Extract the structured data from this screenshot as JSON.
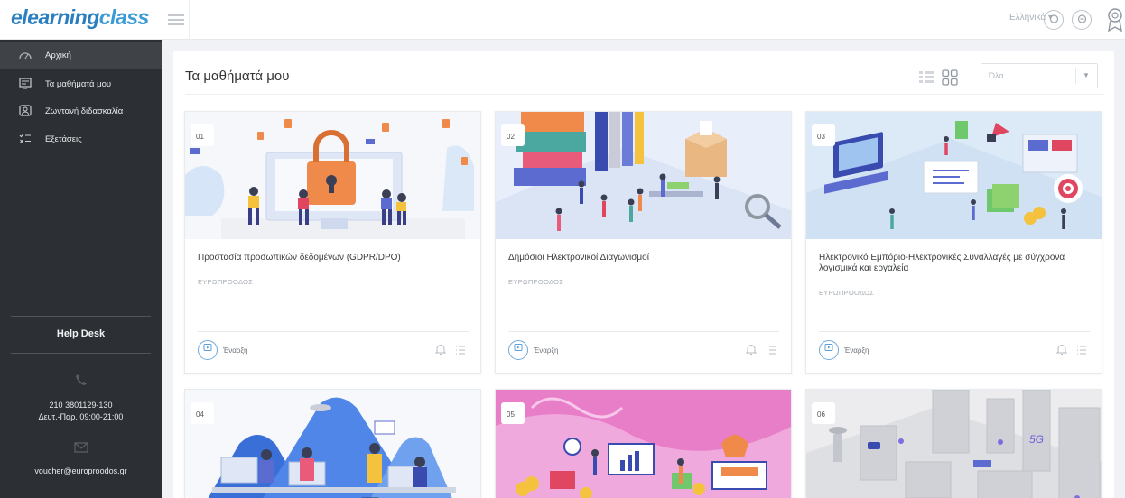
{
  "header": {
    "logo_part1": "elearning",
    "logo_part2": "class",
    "language": "Ελληνικά ▾",
    "colors": {
      "accent": "#2f9bd3",
      "sidebar_bg": "#2c2f33",
      "page_bg": "#f0f2f5"
    }
  },
  "sidebar": {
    "items": [
      {
        "label": "Αρχική",
        "icon": "dashboard-icon"
      },
      {
        "label": "Τα μαθήματά μου",
        "icon": "courses-icon"
      },
      {
        "label": "Ζωντανή διδασκαλία",
        "icon": "live-teaching-icon"
      },
      {
        "label": "Εξετάσεις",
        "icon": "exams-icon"
      }
    ],
    "help": {
      "title": "Help Desk",
      "phone": "210 3801129-130",
      "hours": "Δευτ.-Παρ. 09:00-21:00",
      "email": "voucher@europroodos.gr"
    }
  },
  "main": {
    "title": "Τα μαθήματά μου",
    "filter_value": "Όλα",
    "cards": [
      {
        "num": "01",
        "title": "Προστασία προσωπικών δεδομένων (GDPR/DPO)",
        "subtitle": "ΕΥΡΩΠΡΟΟΔΟΣ",
        "start": "Έναρξη",
        "art": "security"
      },
      {
        "num": "02",
        "title": "Δημόσιοι Ηλεκτρονικοί Διαγωνισμοί",
        "subtitle": "ΕΥΡΩΠΡΟΟΔΟΣ",
        "start": "Έναρξη",
        "art": "procurement"
      },
      {
        "num": "03",
        "title": "Ηλεκτρονικό Εμπόριο-Ηλεκτρονικές Συναλλαγές με σύγχρονα λογισμικά και εργαλεία",
        "subtitle": "ΕΥΡΩΠΡΟΟΔΟΣ",
        "start": "Έναρξη",
        "art": "ecommerce"
      },
      {
        "num": "04",
        "art": "office"
      },
      {
        "num": "05",
        "art": "finance"
      },
      {
        "num": "06",
        "art": "city",
        "badge": "5G"
      }
    ]
  }
}
